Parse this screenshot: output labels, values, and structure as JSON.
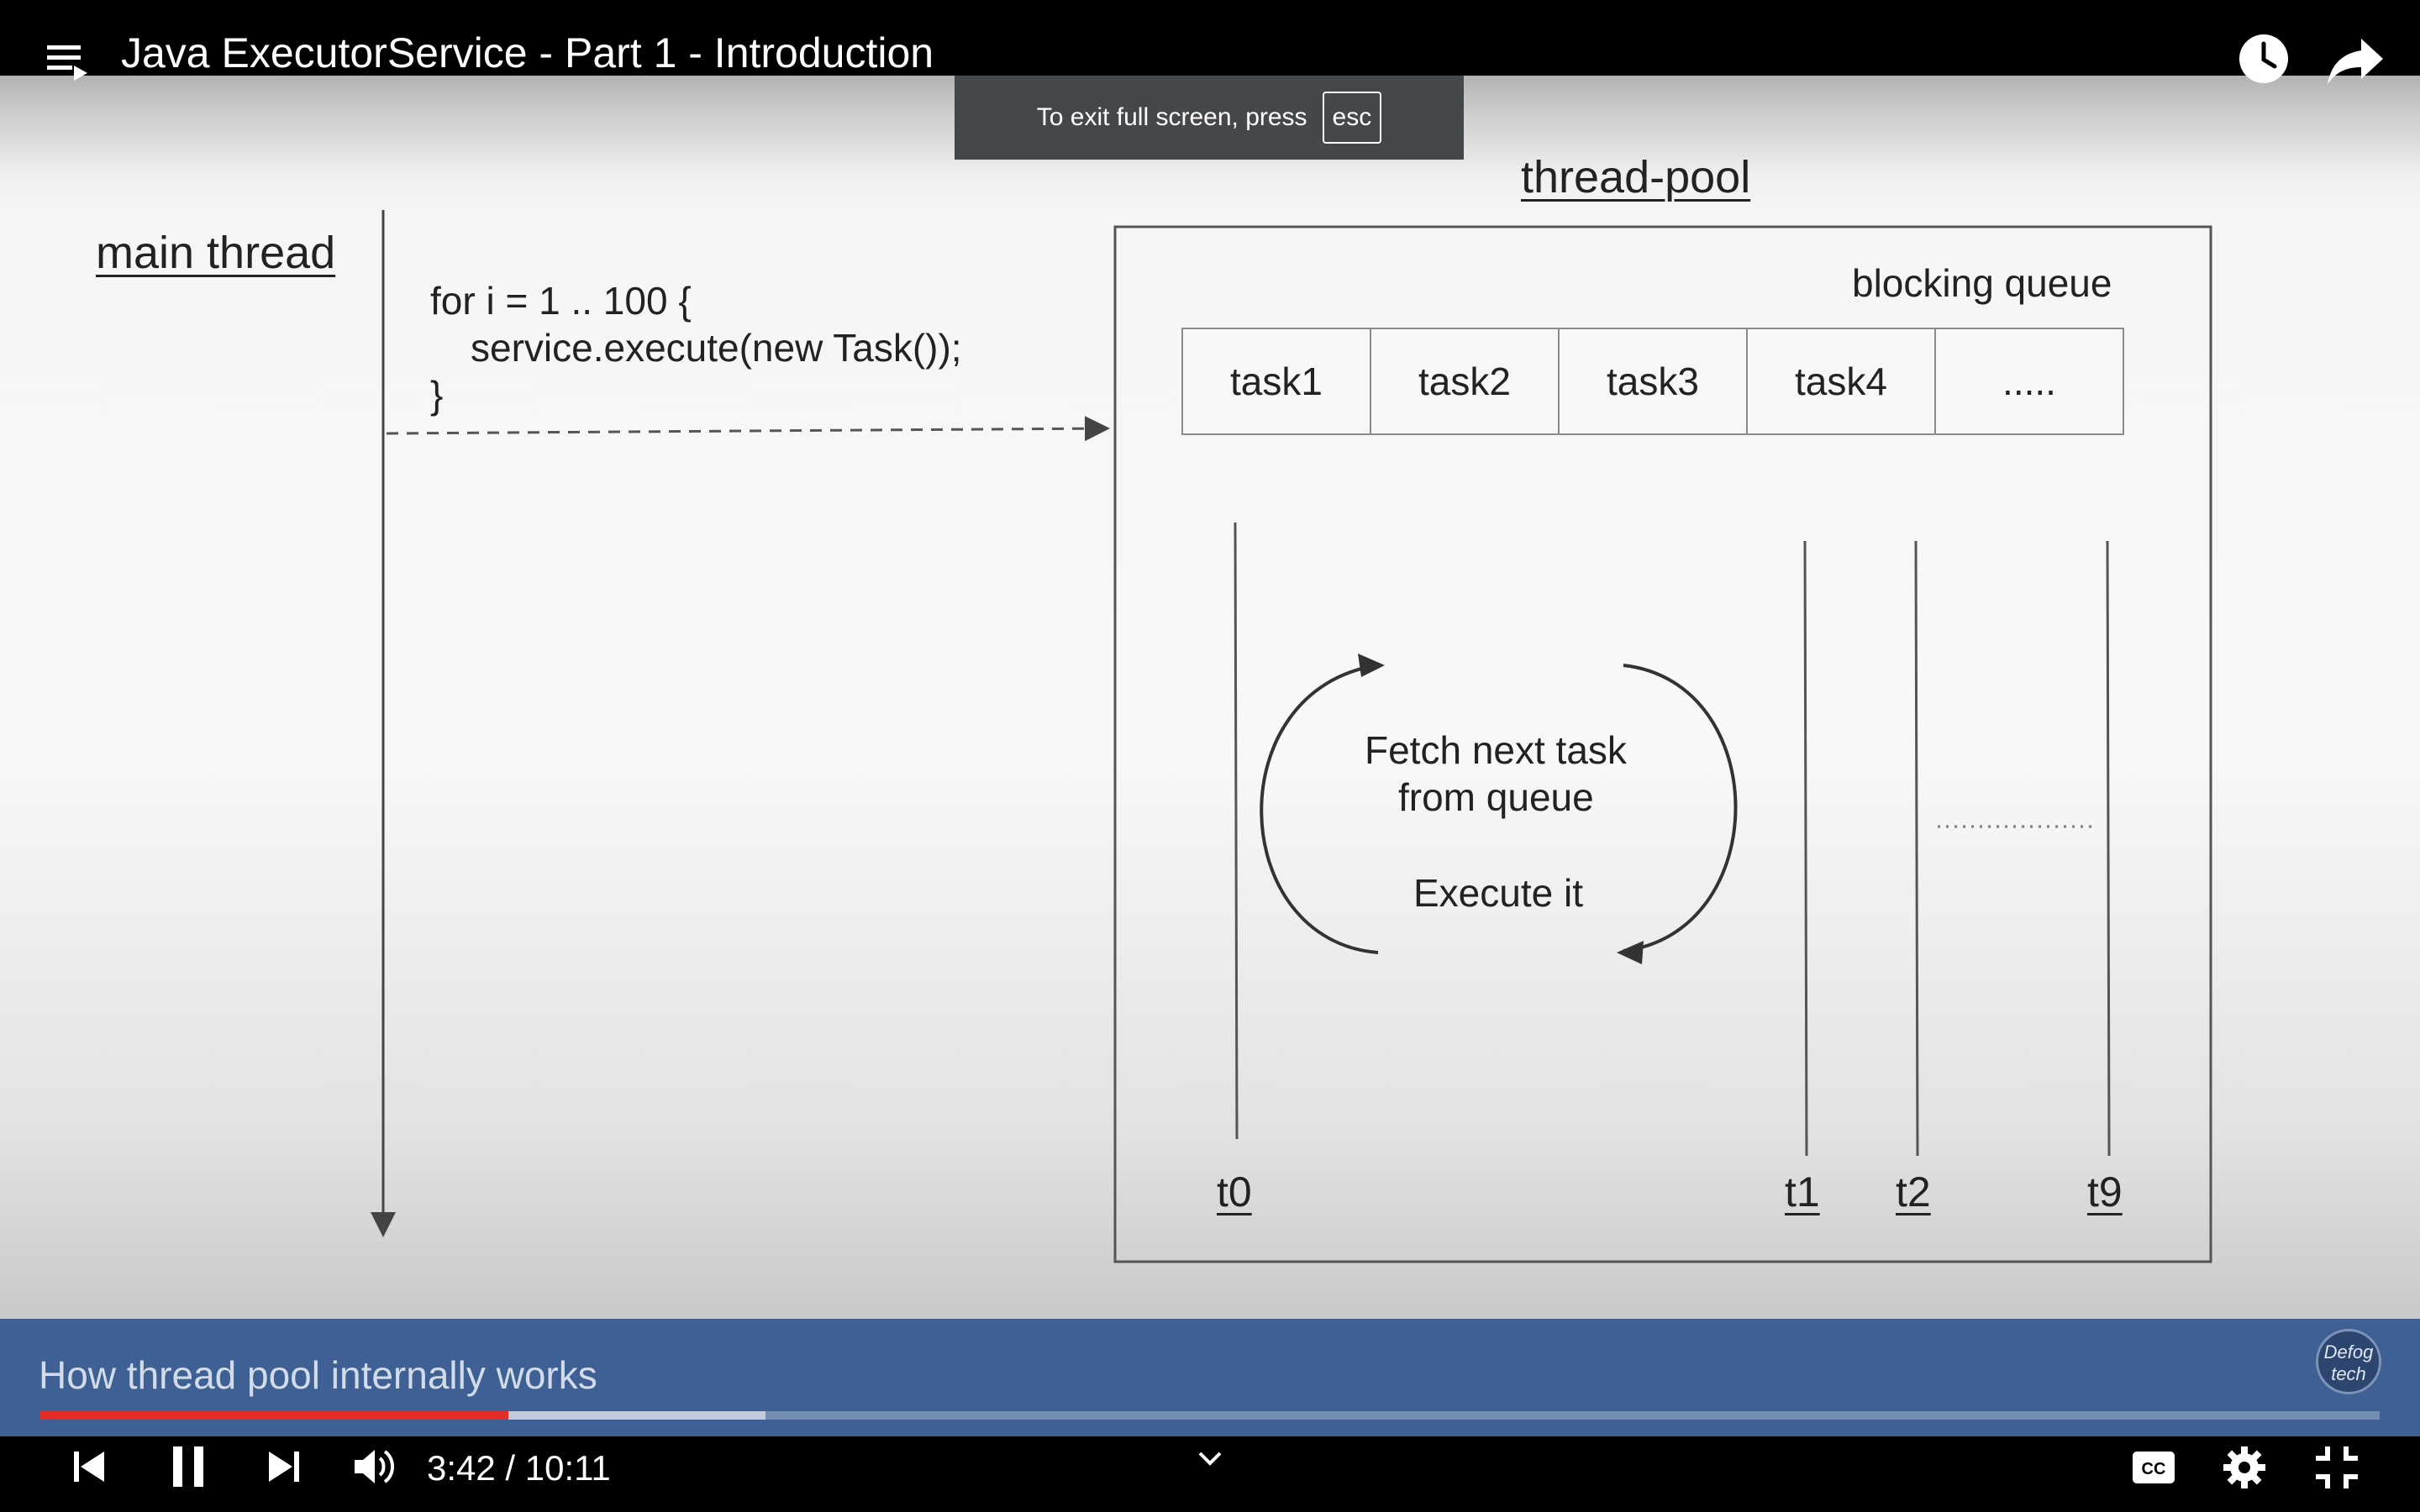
{
  "player": {
    "title": "Java ExecutorService - Part 1 - Introduction",
    "toast_text": "To exit full screen, press",
    "toast_key": "esc",
    "banner_text": "How thread pool internally works",
    "channel_logo": "Defog tech",
    "time_current": "3:42",
    "time_total": "10:11",
    "progress_played": 0.2,
    "progress_buffered": 0.31,
    "colors": {
      "accent": "#e52d27",
      "banner": "#3e6094"
    },
    "icons": [
      "playlist-icon",
      "watch-later-icon",
      "share-icon",
      "previous-icon",
      "pause-icon",
      "next-icon",
      "volume-icon",
      "chevron-down-icon",
      "captions-icon",
      "settings-icon",
      "exit-fullscreen-icon"
    ]
  },
  "diagram": {
    "main_thread_label": "main thread",
    "code_lines": [
      "for i = 1 .. 100 {",
      "service.execute(new Task());",
      "}"
    ],
    "pool_label": "thread-pool",
    "queue_label": "blocking queue",
    "queue_cells": [
      "task1",
      "task2",
      "task3",
      "task4",
      "....."
    ],
    "loop_text": [
      "Fetch next task",
      "from queue",
      "Execute it"
    ],
    "threads": [
      "t0",
      "t1",
      "t2",
      "t9"
    ]
  }
}
